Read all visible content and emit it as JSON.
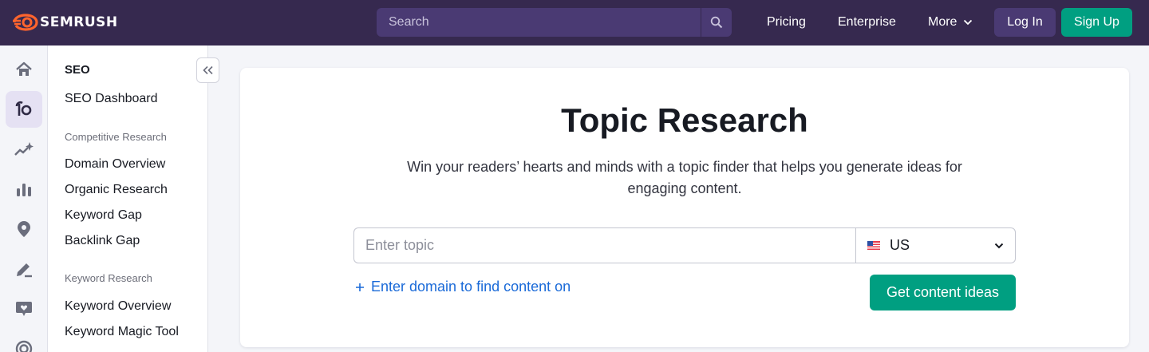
{
  "brand": {
    "name": "SEMRUSH",
    "accent": "#ff642d",
    "nav_bg": "#36294f",
    "cta_color": "#009f81",
    "link_color": "#1a6ad8"
  },
  "header": {
    "search_placeholder": "Search",
    "links": [
      "Pricing",
      "Enterprise",
      "More"
    ],
    "login_label": "Log In",
    "signup_label": "Sign Up"
  },
  "rail": {
    "icons": [
      "home-icon",
      "seo-icon",
      "sparkle-chart-icon",
      "bar-chart-icon",
      "location-pin-icon",
      "pen-icon",
      "chat-heart-icon",
      "target-icon"
    ],
    "active": "seo-icon"
  },
  "sidebar": {
    "title": "SEO",
    "dashboard": "SEO Dashboard",
    "groups": [
      {
        "label": "Competitive Research",
        "items": [
          "Domain Overview",
          "Organic Research",
          "Keyword Gap",
          "Backlink Gap"
        ]
      },
      {
        "label": "Keyword Research",
        "items": [
          "Keyword Overview",
          "Keyword Magic Tool"
        ]
      }
    ]
  },
  "main": {
    "title": "Topic Research",
    "subtitle": "Win your readers’ hearts and minds with a topic finder that helps you generate ideas for engaging content.",
    "topic_placeholder": "Enter topic",
    "country": "US",
    "add_domain_label": "Enter domain to find content on",
    "cta_label": "Get content ideas"
  }
}
